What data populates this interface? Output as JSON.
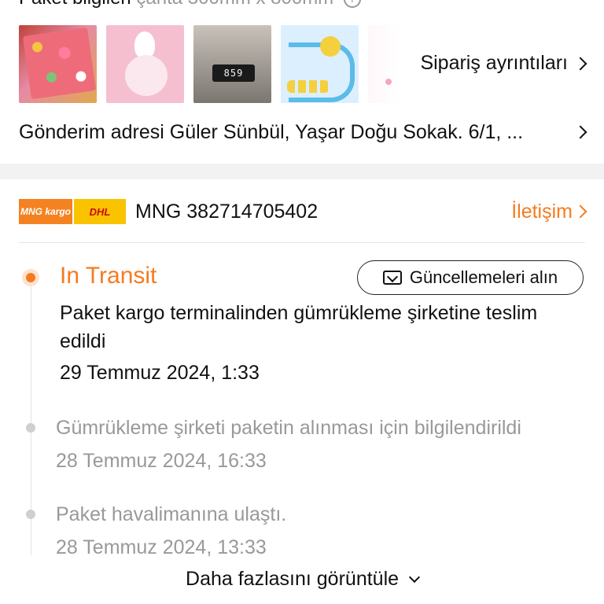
{
  "package": {
    "title_prefix": "Paket bilgileri",
    "title_muted": "çanta 300mm x 800mm"
  },
  "thumbnails": {
    "clock_text": "859"
  },
  "order": {
    "link_label": "Sipariş ayrıntıları"
  },
  "shipping": {
    "address_text": "Gönderim adresi Güler Sünbül, Yaşar Doğu Sokak. 6/1, ..."
  },
  "carrier": {
    "logo_left": "MNG kargo",
    "logo_right": "DHL",
    "tracking_text": "MNG 382714705402",
    "contact_label": "İletişim",
    "accent_color": "#f57b20"
  },
  "tracking": {
    "status": "In Transit",
    "updates_button": "Güncellemeleri alın",
    "events": [
      {
        "text": "Paket kargo terminalinden gümrükleme şirketine teslim edildi",
        "time": "29 Temmuz 2024, 1:33"
      },
      {
        "text": "Gümrükleme şirketi paketin alınması için bilgilendirildi",
        "time": "28 Temmuz 2024, 16:33"
      },
      {
        "text": "Paket havalimanına ulaştı.",
        "time": "28 Temmuz 2024, 13:33"
      }
    ],
    "more_label": "Daha fazlasını görüntüle"
  }
}
